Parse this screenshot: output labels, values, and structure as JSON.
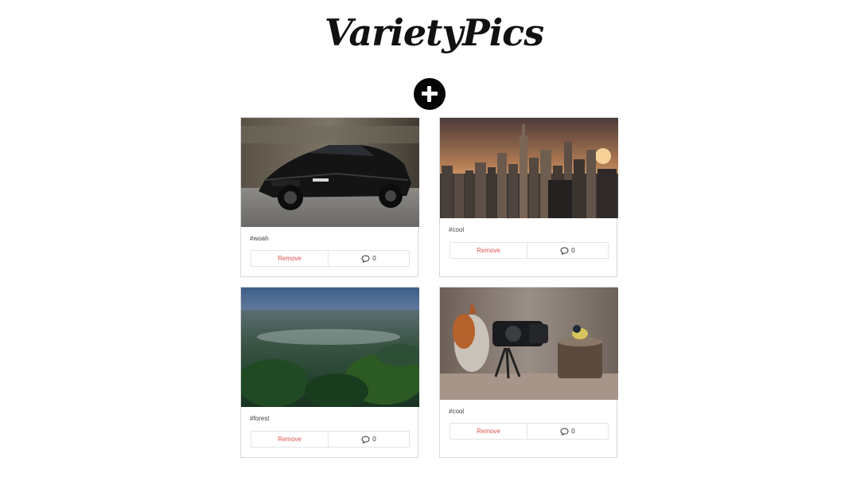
{
  "header": {
    "logo_text": "VarietyPics"
  },
  "add_button": {
    "icon": "plus-icon"
  },
  "cards": [
    {
      "image": "black sports car on road",
      "tag": "#woah",
      "remove_label": "Remove",
      "comment_count": "0"
    },
    {
      "image": "city skyline at sunset",
      "tag": "#cool",
      "remove_label": "Remove",
      "comment_count": "0"
    },
    {
      "image": "misty forest canopy",
      "tag": "#forest",
      "remove_label": "Remove",
      "comment_count": "0"
    },
    {
      "image": "squirrel with camera and bird",
      "tag": "#cool",
      "remove_label": "Remove",
      "comment_count": "0"
    }
  ],
  "colors": {
    "remove": "#d9534f",
    "border": "#d8d8d8",
    "button": "#050505"
  }
}
